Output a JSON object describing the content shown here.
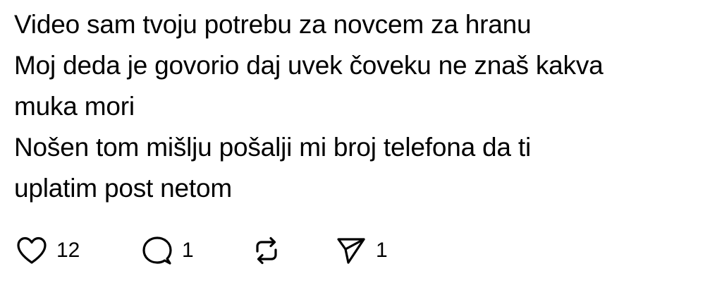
{
  "post": {
    "lines": [
      "Video sam tvoju potrebu za novcem za hranu",
      "Moj deda je govorio daj uvek čoveku ne znaš kakva",
      "muka mori",
      "Nošen tom mišlju pošalji mi broj telefona da ti",
      "uplatim post netom"
    ]
  },
  "actions": {
    "like": {
      "icon": "heart-icon",
      "count": "12"
    },
    "reply": {
      "icon": "comment-icon",
      "count": "1"
    },
    "repost": {
      "icon": "repost-icon",
      "count": ""
    },
    "share": {
      "icon": "send-icon",
      "count": "1"
    }
  },
  "colors": {
    "text": "#000000",
    "background": "#ffffff"
  }
}
